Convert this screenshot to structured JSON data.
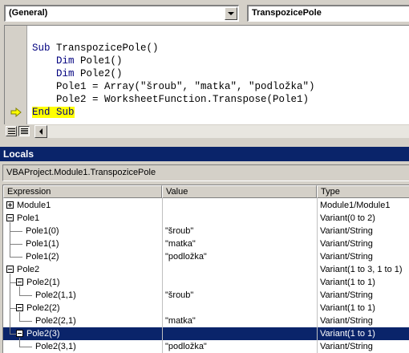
{
  "code_window": {
    "object_combo": "(General)",
    "procedure_combo": "TranspozicePole",
    "lines": [
      {
        "parts": [
          {
            "t": "Sub ",
            "k": true
          },
          {
            "t": "TranspozicePole()",
            "k": false
          }
        ]
      },
      {
        "parts": [
          {
            "t": "    Dim ",
            "k": true
          },
          {
            "t": "Pole1()",
            "k": false
          }
        ]
      },
      {
        "parts": [
          {
            "t": "    Dim ",
            "k": true
          },
          {
            "t": "Pole2()",
            "k": false
          }
        ]
      },
      {
        "parts": [
          {
            "t": "    Pole1 = Array(\"šroub\", \"matka\", \"podložka\")",
            "k": false
          }
        ]
      },
      {
        "parts": [
          {
            "t": "    Pole2 = WorksheetFunction.Transpose(Pole1)",
            "k": false
          }
        ]
      },
      {
        "parts": [
          {
            "t": "End ",
            "k": true,
            "hl": true
          },
          {
            "t": "Sub",
            "k": true,
            "hl": true
          }
        ]
      }
    ]
  },
  "locals": {
    "title": "Locals",
    "context": "VBAProject.Module1.TranspozicePole",
    "columns": [
      "Expression",
      "Value",
      "Type"
    ],
    "rows": [
      {
        "expr": "Module1",
        "value": "",
        "type": "Module1/Module1",
        "level": 0,
        "expander": "plus"
      },
      {
        "expr": "Pole1",
        "value": "",
        "type": "Variant(0 to 2)",
        "level": 0,
        "expander": "minus"
      },
      {
        "expr": "Pole1(0)",
        "value": "\"šroub\"",
        "type": "Variant/String",
        "level": 1,
        "expander": ""
      },
      {
        "expr": "Pole1(1)",
        "value": "\"matka\"",
        "type": "Variant/String",
        "level": 1,
        "expander": ""
      },
      {
        "expr": "Pole1(2)",
        "value": "\"podložka\"",
        "type": "Variant/String",
        "level": 1,
        "expander": ""
      },
      {
        "expr": "Pole2",
        "value": "",
        "type": "Variant(1 to 3, 1 to 1)",
        "level": 0,
        "expander": "minus"
      },
      {
        "expr": "Pole2(1)",
        "value": "",
        "type": "Variant(1 to 1)",
        "level": 1,
        "expander": "minus"
      },
      {
        "expr": "Pole2(1,1)",
        "value": "\"šroub\"",
        "type": "Variant/String",
        "level": 2,
        "expander": ""
      },
      {
        "expr": "Pole2(2)",
        "value": "",
        "type": "Variant(1 to 1)",
        "level": 1,
        "expander": "minus"
      },
      {
        "expr": "Pole2(2,1)",
        "value": "\"matka\"",
        "type": "Variant/String",
        "level": 2,
        "expander": ""
      },
      {
        "expr": "Pole2(3)",
        "value": "",
        "type": "Variant(1 to 1)",
        "level": 1,
        "expander": "minus",
        "selected": true
      },
      {
        "expr": "Pole2(3,1)",
        "value": "\"podložka\"",
        "type": "Variant/String",
        "level": 2,
        "expander": ""
      }
    ]
  },
  "icons": {
    "exec_arrow": "execution-pointer-arrow-icon",
    "procedure_view": "procedure-view-icon",
    "module_view": "full-module-view-icon"
  },
  "colors": {
    "keyword": "#00007f",
    "highlight": "#ffff00",
    "selection": "#0a246a",
    "exec_arrow": "#ffff00"
  }
}
